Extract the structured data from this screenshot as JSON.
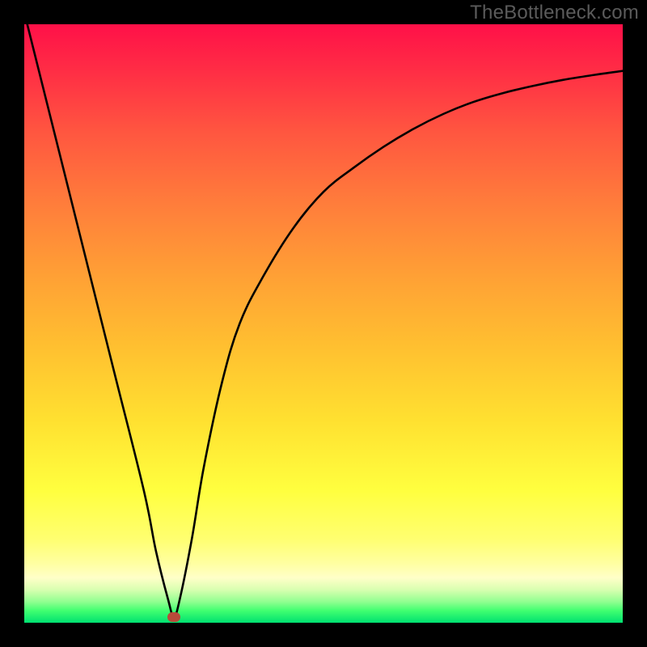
{
  "watermark": "TheBottleneck.com",
  "chart_data": {
    "type": "line",
    "title": "",
    "xlabel": "",
    "ylabel": "",
    "xlim": [
      0,
      100
    ],
    "ylim": [
      0,
      100
    ],
    "grid": false,
    "series": [
      {
        "name": "bottleneck-curve",
        "x": [
          0,
          5,
          10,
          15,
          20,
          22,
          24,
          25,
          26,
          28,
          30,
          33,
          36,
          40,
          45,
          50,
          55,
          60,
          65,
          70,
          75,
          80,
          85,
          90,
          95,
          100
        ],
        "values": [
          102,
          82,
          62,
          42,
          22,
          12,
          4,
          1,
          4,
          14,
          26,
          40,
          50,
          58,
          66,
          72,
          76,
          79.5,
          82.5,
          85,
          87,
          88.5,
          89.7,
          90.7,
          91.5,
          92.2
        ]
      }
    ],
    "marker": {
      "x": 25,
      "y": 1
    },
    "background": {
      "type": "vertical-gradient",
      "stops": [
        {
          "pct": 0,
          "color": "#ff1048"
        },
        {
          "pct": 30,
          "color": "#ff7d3b"
        },
        {
          "pct": 66,
          "color": "#ffe030"
        },
        {
          "pct": 86,
          "color": "#ffff70"
        },
        {
          "pct": 96,
          "color": "#90ff90"
        },
        {
          "pct": 100,
          "color": "#00e070"
        }
      ]
    }
  }
}
